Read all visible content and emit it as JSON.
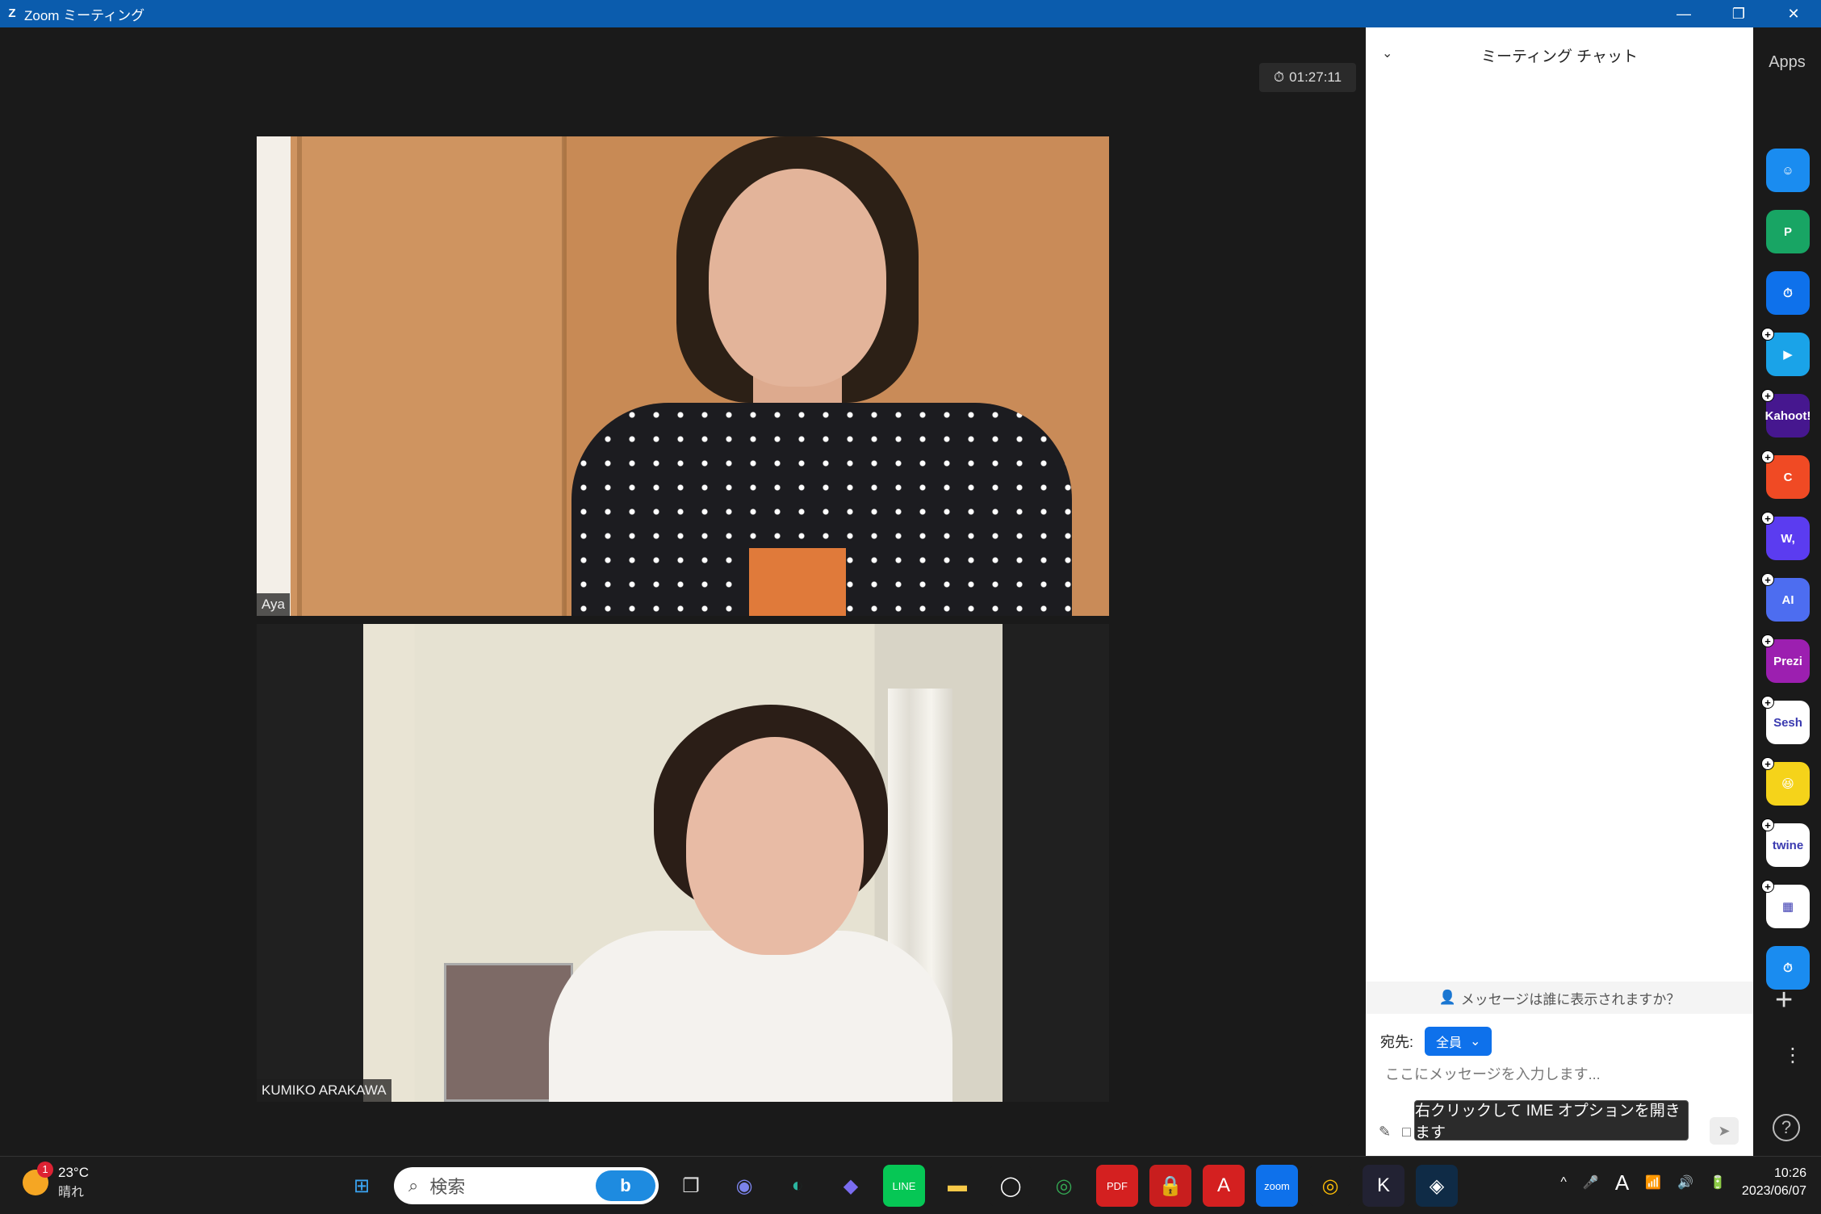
{
  "window": {
    "title": "Zoom ミーティング",
    "logo": "Z",
    "minimize": "—",
    "restore": "❐",
    "close": "✕"
  },
  "meeting": {
    "timer": "01:27:11",
    "timer_icon": "⏱"
  },
  "participants": [
    {
      "name": "Aya"
    },
    {
      "name": "KUMIKO ARAKAWA"
    }
  ],
  "chat": {
    "collapse_icon": "⌄",
    "title": "ミーティング チャット",
    "visibility_icon": "👤",
    "visibility_text": "メッセージは誰に表示されますか？",
    "to_label": "宛先:",
    "to_value": "全員",
    "to_chevron": "⌄",
    "placeholder": "ここにメッセージを入力します...",
    "tools": [
      "✎",
      "□",
      "▭",
      "☺"
    ],
    "send_icon": "➤",
    "tooltip": "右クリックして IME オプションを開きます"
  },
  "apps": {
    "label": "Apps",
    "icons": [
      {
        "name": "smiley-app-icon",
        "text": "☺",
        "color": "#1a8cf0",
        "plus": false
      },
      {
        "name": "p-app-icon",
        "text": "P",
        "color": "#18a564",
        "plus": false
      },
      {
        "name": "timer-app-icon",
        "text": "⏱",
        "color": "#0e71eb",
        "plus": false
      },
      {
        "name": "flag-app-icon",
        "text": "▶",
        "color": "#1aa3e8",
        "plus": true
      },
      {
        "name": "kahoot-app-icon",
        "text": "Kahoot!",
        "color": "#46178f",
        "plus": true
      },
      {
        "name": "c-app-icon",
        "text": "C",
        "color": "#f04a24",
        "plus": true
      },
      {
        "name": "w-app-icon",
        "text": "W,",
        "color": "#5b3cf0",
        "plus": true
      },
      {
        "name": "ai-app-icon",
        "text": "AI",
        "color": "#4d6df0",
        "plus": true
      },
      {
        "name": "prezi-app-icon",
        "text": "Prezi",
        "color": "#9c1fb0",
        "plus": true
      },
      {
        "name": "sesh-app-icon",
        "text": "Sesh",
        "color": "#ffffff",
        "plus": true
      },
      {
        "name": "emoji-app-icon",
        "text": "😆",
        "color": "#f5d31a",
        "plus": true
      },
      {
        "name": "twine-app-icon",
        "text": "twine",
        "color": "#ffffff",
        "plus": true
      },
      {
        "name": "blocks-app-icon",
        "text": "▦",
        "color": "#ffffff",
        "plus": true
      },
      {
        "name": "stopwatch-app-icon",
        "text": "⏱",
        "color": "#1a8cf0",
        "plus": false
      }
    ],
    "add": "+",
    "more": "⋮",
    "help": "?"
  },
  "taskbar": {
    "weather_temp": "23°C",
    "weather_text": "晴れ",
    "weather_badge": "1",
    "search_placeholder": "検索",
    "search_icon": "⌕",
    "bing": "b",
    "pinned": [
      {
        "name": "windows-start-icon",
        "text": "⊞",
        "color": "#1c1c1c",
        "fg": "#3ba6f5"
      },
      {
        "name": "task-view-icon",
        "text": "❐",
        "color": "#1c1c1c",
        "fg": "#ddd"
      },
      {
        "name": "teams-icon",
        "text": "◉",
        "color": "#1c1c1c",
        "fg": "#7b83eb"
      },
      {
        "name": "edge-icon",
        "text": "◐",
        "color": "#1c1c1c",
        "fg": "#2bb5a0"
      },
      {
        "name": "copilot-icon",
        "text": "◆",
        "color": "#1c1c1c",
        "fg": "#7a6cf0"
      },
      {
        "name": "line-icon",
        "text": "LINE",
        "color": "#06c755",
        "fg": "#fff"
      },
      {
        "name": "file-explorer-icon",
        "text": "▬",
        "color": "#1c1c1c",
        "fg": "#f7c948"
      },
      {
        "name": "whatsapp-icon",
        "text": "◯",
        "color": "#1c1c1c",
        "fg": "#fff"
      },
      {
        "name": "chrome-icon",
        "text": "◎",
        "color": "#1c1c1c",
        "fg": "#34a853"
      },
      {
        "name": "pdf-icon",
        "text": "PDF",
        "color": "#d42020",
        "fg": "#fff"
      },
      {
        "name": "security-icon",
        "text": "🔒",
        "color": "#c81e1e",
        "fg": "#fff"
      },
      {
        "name": "acrobat-icon",
        "text": "A",
        "color": "#d42020",
        "fg": "#fff"
      },
      {
        "name": "zoom-icon",
        "text": "zoom",
        "color": "#0e71eb",
        "fg": "#fff"
      },
      {
        "name": "chrome-profile-icon",
        "text": "◎",
        "color": "#1c1c1c",
        "fg": "#fbbc05"
      },
      {
        "name": "app-k-icon",
        "text": "K",
        "color": "#223",
        "fg": "#fff"
      },
      {
        "name": "deepl-icon",
        "text": "◈",
        "color": "#0f2b46",
        "fg": "#fff"
      }
    ],
    "tray_icons": [
      "^",
      "🎤",
      "A",
      "📶",
      "🔊",
      "🔋"
    ],
    "time": "10:26",
    "date": "2023/06/07"
  }
}
